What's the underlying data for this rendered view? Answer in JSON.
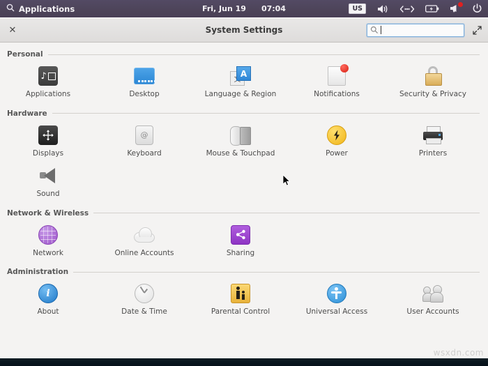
{
  "panel": {
    "menu_label": "Applications",
    "menu_icon": "search-icon",
    "clock_date": "Fri, Jun 19",
    "clock_time": "07:04",
    "keyboard_layout": "US",
    "tray": [
      {
        "name": "keyboard-layout-indicator",
        "label": "US"
      },
      {
        "name": "volume-icon",
        "label": "🔊"
      },
      {
        "name": "network-icon",
        "label": "‹···›"
      },
      {
        "name": "battery-icon",
        "label": "🔋"
      },
      {
        "name": "notifications-icon",
        "label": "🔔"
      },
      {
        "name": "power-icon",
        "label": "⏻"
      }
    ]
  },
  "window": {
    "title": "System Settings",
    "close_label": "✕",
    "maximize_label": "⤡",
    "search": {
      "value": "",
      "placeholder": "",
      "icon": "search-icon"
    }
  },
  "sections": [
    {
      "title": "Personal",
      "items": [
        {
          "label": "Applications",
          "icon": "applications-icon"
        },
        {
          "label": "Desktop",
          "icon": "desktop-icon"
        },
        {
          "label": "Language & Region",
          "icon": "language-region-icon"
        },
        {
          "label": "Notifications",
          "icon": "notifications-icon"
        },
        {
          "label": "Security & Privacy",
          "icon": "lock-icon"
        }
      ]
    },
    {
      "title": "Hardware",
      "items": [
        {
          "label": "Displays",
          "icon": "displays-icon"
        },
        {
          "label": "Keyboard",
          "icon": "keyboard-icon"
        },
        {
          "label": "Mouse & Touchpad",
          "icon": "mouse-touchpad-icon"
        },
        {
          "label": "Power",
          "icon": "power-bolt-icon"
        },
        {
          "label": "Printers",
          "icon": "printer-icon"
        },
        {
          "label": "Sound",
          "icon": "speaker-icon"
        }
      ]
    },
    {
      "title": "Network & Wireless",
      "items": [
        {
          "label": "Network",
          "icon": "globe-icon"
        },
        {
          "label": "Online Accounts",
          "icon": "cloud-icon"
        },
        {
          "label": "Sharing",
          "icon": "share-icon"
        }
      ]
    },
    {
      "title": "Administration",
      "items": [
        {
          "label": "About",
          "icon": "info-icon"
        },
        {
          "label": "Date & Time",
          "icon": "clock-icon"
        },
        {
          "label": "Parental Control",
          "icon": "parental-control-icon"
        },
        {
          "label": "Universal Access",
          "icon": "accessibility-icon"
        },
        {
          "label": "User Accounts",
          "icon": "users-icon"
        }
      ]
    }
  ],
  "watermark": "wsxdn.com",
  "colors": {
    "panel": "#4d4459",
    "accent_blue": "#2a86d4",
    "accent_purple": "#9b51c8",
    "accent_yellow": "#f0b417",
    "badge_red": "#d71f13"
  }
}
